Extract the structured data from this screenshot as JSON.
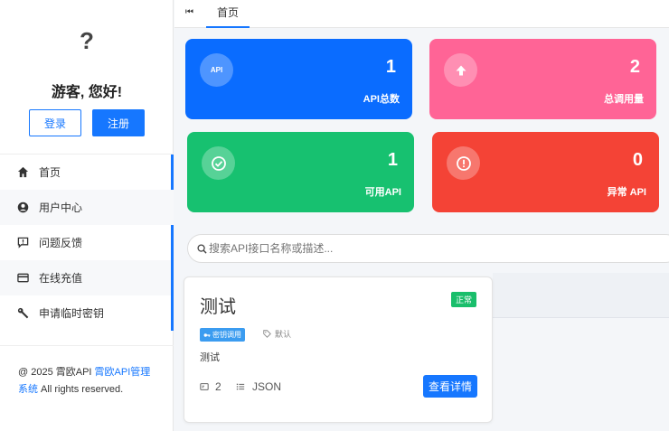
{
  "sidebar": {
    "avatar_text": "?",
    "greeting": "游客, 您好!",
    "login_label": "登录",
    "register_label": "注册",
    "items": [
      {
        "label": "首页",
        "icon": "home-icon"
      },
      {
        "label": "用户中心",
        "icon": "user-icon"
      },
      {
        "label": "问题反馈",
        "icon": "feedback-icon"
      },
      {
        "label": "在线充值",
        "icon": "card-icon"
      },
      {
        "label": "申请临时密钥",
        "icon": "key-icon"
      }
    ],
    "footer": {
      "prefix": "@ 2025 霄欧API ",
      "link": "霄欧API管理系统",
      "suffix": " All rights reserved."
    }
  },
  "topbar": {
    "prev_icon": "⏮",
    "home_tab": "首页"
  },
  "stats": [
    {
      "value": "1",
      "label": "API总数",
      "color": "#0a6cff",
      "icon": "api-icon",
      "icon_text": "API"
    },
    {
      "value": "2",
      "label": "总调用量",
      "color": "#ff6496",
      "icon": "upload-arrow-icon"
    },
    {
      "value": "1",
      "label": "可用API",
      "color": "#17c170",
      "icon": "check-circle-icon"
    },
    {
      "value": "0",
      "label": "异常 API",
      "color": "#f44336",
      "icon": "alert-circle-icon"
    }
  ],
  "search": {
    "placeholder": "搜索API接口名称或描述..."
  },
  "api_card": {
    "title": "测试",
    "status": "正常",
    "tag": "密钥调用",
    "tag_default": "默认",
    "description": "测试",
    "call_count": "2",
    "format": "JSON",
    "detail_label": "查看详情"
  }
}
